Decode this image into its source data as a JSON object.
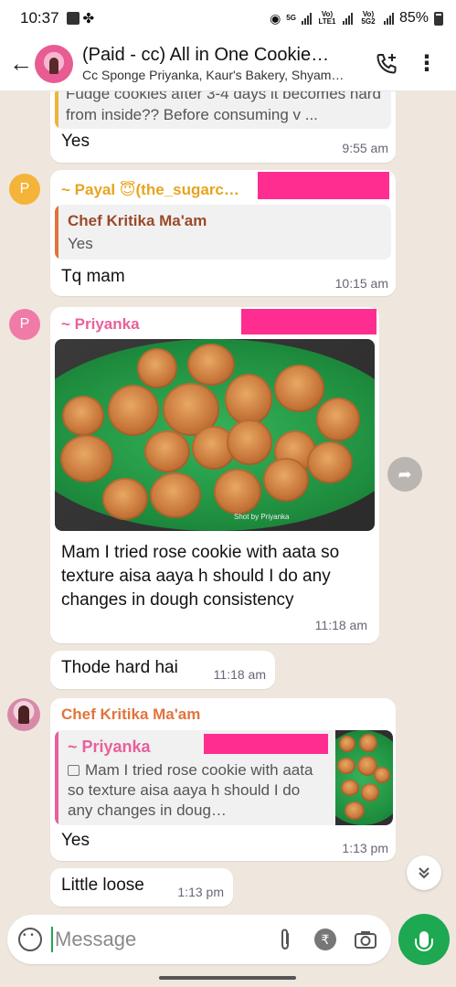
{
  "status_bar": {
    "time": "10:37",
    "network1": "Vo) LTE1",
    "network2": "Vo) 5G2",
    "fiveg": "5G",
    "battery": "85%"
  },
  "header": {
    "title": "(Paid - cc) All in One Cookie…",
    "subtitle": "Cc Sponge Priyanka, Kaur's Bakery, Shyam…"
  },
  "messages": {
    "m1": {
      "quote_text": "Fudge cookies after 3-4 days it becomes hard from inside?? Before consuming v ...",
      "text": "Yes",
      "time": "9:55 am"
    },
    "m2": {
      "avatar_letter": "P",
      "sender": "~ Payal 😇(the_sugarc…",
      "quote_sender": "Chef Kritika Ma'am",
      "quote_text": "Yes",
      "text": "Tq mam",
      "time": "10:15 am"
    },
    "m3": {
      "avatar_letter": "P",
      "sender": "~ Priyanka",
      "image_caption": "Shot by Priyanka",
      "text": "Mam I tried rose cookie with aata so texture aisa aaya h should I do any changes in dough consistency",
      "time": "11:18 am"
    },
    "m4": {
      "text": "Thode hard hai",
      "time": "11:18 am"
    },
    "m5": {
      "sender": "Chef Kritika Ma'am",
      "quote_sender": "~ Priyanka",
      "quote_text": "Mam I tried rose cookie with aata so texture aisa aaya h should I do any changes in doug…",
      "text": "Yes",
      "time": "1:13 pm"
    },
    "m6": {
      "text": "Little loose",
      "time": "1:13 pm"
    }
  },
  "composer": {
    "placeholder": "Message",
    "rupee_symbol": "₹"
  },
  "colors": {
    "accent": "#1da851",
    "redaction": "#ff2d8f",
    "sender_payal": "#e8a41f",
    "sender_priyanka": "#e8609a",
    "sender_chef": "#e0743d",
    "quote_chef_name": "#9a4a2a"
  }
}
